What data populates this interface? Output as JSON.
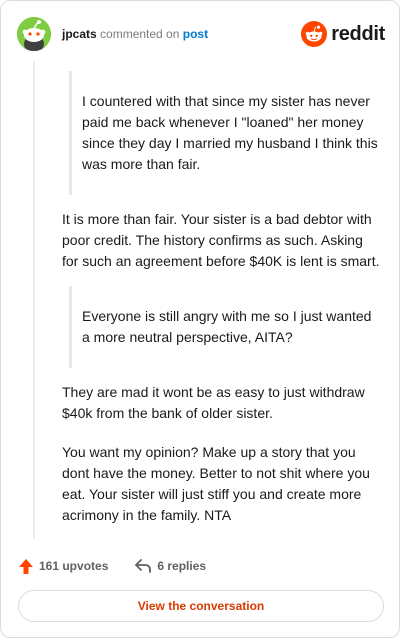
{
  "header": {
    "username": "jpcats",
    "action_text": "commented on",
    "post_link": "post",
    "brand": "reddit"
  },
  "comment": {
    "quote1": "I countered with that since my sister has never paid me back whenever I \"loaned\" her money since they day I married my husband I think this was more than fair.",
    "para1": "It is more than fair. Your sister is a bad debtor with poor credit. The history confirms as such. Asking for such an agreement before $40K is lent is smart.",
    "quote2": "Everyone is still angry with me so I just wanted a more neutral perspective, AITA?",
    "para2": "They are mad it wont be as easy to just withdraw $40k from the bank of older sister.",
    "para3": "You want my opinion? Make up a story that you dont have the money. Better to not shit where you eat. Your sister will just stiff you and create more acrimony in the family. NTA"
  },
  "footer": {
    "upvotes": "161 upvotes",
    "replies": "6 replies",
    "cta": "View the conversation"
  },
  "colors": {
    "avatar_bg": "#7fcc43",
    "brand_orange": "#ff4500",
    "link_blue": "#0079d3",
    "cta_text": "#d93a00"
  },
  "icons": [
    "snoo-avatar-icon",
    "reddit-logo-icon",
    "upvote-arrow-icon",
    "reply-arrow-icon"
  ]
}
